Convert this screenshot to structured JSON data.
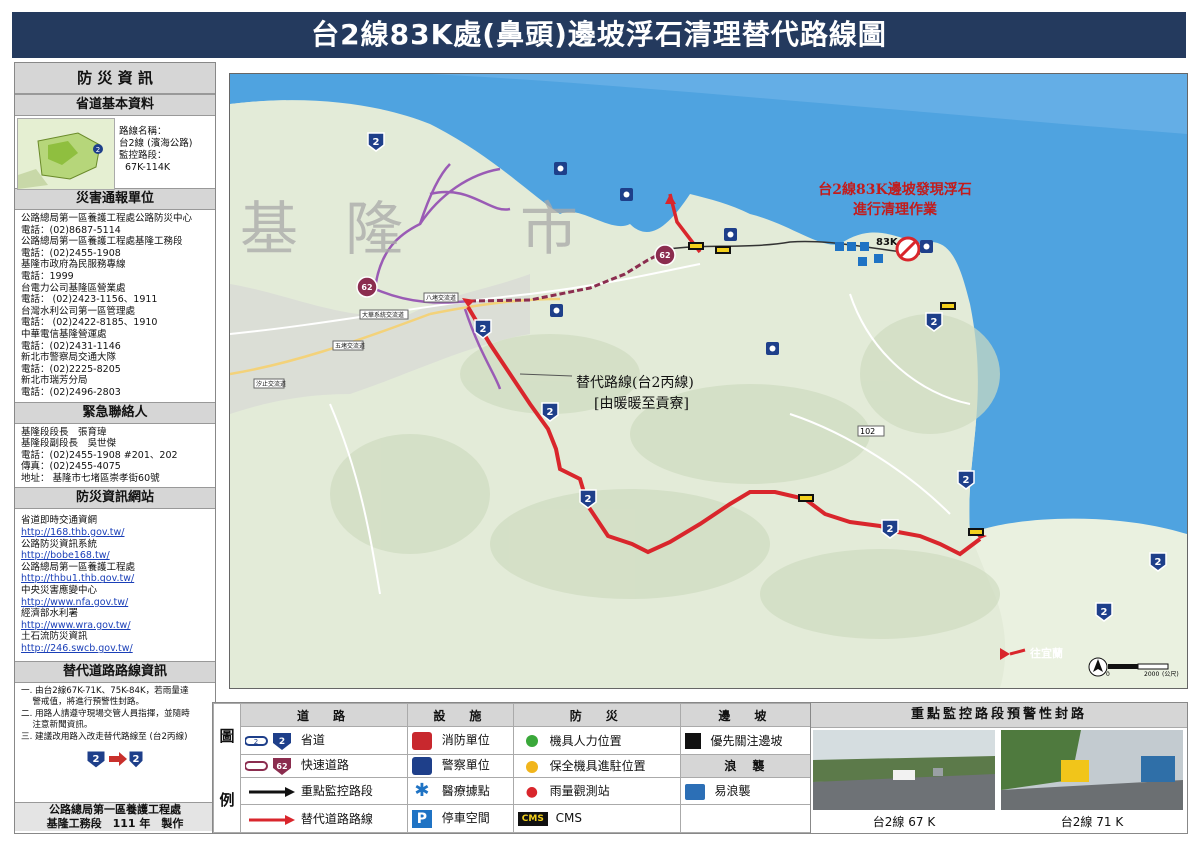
{
  "title": "台2線83K處(鼻頭)邊坡浮石清理替代路線圖",
  "sidebar": {
    "header": "防 災 資 訊",
    "basic_header": "省道基本資料",
    "road_info": [
      "路線名稱：",
      "台2線 (濱海公路)",
      "監控路段：",
      "67K-114K"
    ],
    "report_header": "災害通報單位",
    "report_lines": [
      "公路總局第一區養護工程處公路防災中心",
      "電話：(02)8687-5114",
      "公路總局第一區養護工程處基隆工務段",
      "電話：(02)2455-1908",
      "基隆市政府為民服務專線",
      "電話：1999",
      "台電力公司基隆區營業處",
      "電話： (02)2423-1156、1911",
      "台灣水利公司第一區管理處",
      "電話： (02)2422-8185、1910",
      "中華電信基隆營運處",
      "電話：(02)2431-1146",
      "新北市警察局交通大隊",
      "電話：(02)2225-8205",
      "新北市瑞芳分局",
      "電話：(02)2496-2803"
    ],
    "contact_header": "緊急聯絡人",
    "contact_lines": [
      "基隆段段長　張育瑋",
      "基隆段副段長　吳世傑",
      "電話：(02)2455-1908 #201、202",
      "傳真：(02)2455-4075",
      "地址： 基隆市七堵區崇孝街60號"
    ],
    "web_header": "防災資訊網站",
    "web_items": [
      {
        "label": "省道即時交通資網",
        "url": "http://168.thb.gov.tw/"
      },
      {
        "label": "公路防災資訊系統",
        "url": "http://bobe168.tw/"
      },
      {
        "label": "公路總局第一區養護工程處",
        "url": "http://thbu1.thb.gov.tw/"
      },
      {
        "label": "中央災害應變中心",
        "url": "http://www.nfa.gov.tw/"
      },
      {
        "label": "經濟部水利署",
        "url": "http://www.wra.gov.tw/"
      },
      {
        "label": "土石流防災資訊",
        "url": "http://246.swcb.gov.tw/"
      }
    ],
    "detour_header": "替代道路路線資訊",
    "detour_lines": [
      "一. 由台2線67K-71K、75K-84K，若雨量達",
      "　 警戒值，將進行預警性封路。",
      "二. 用路人請遵守現場交管人員指揮，並隨時",
      "　 注意新聞資訊。",
      "三. 建議改用路入改走替代路線至 (台2丙線)"
    ],
    "footer": [
      "公路總局第一區養護工程處",
      "基隆工務段　111 年　製作"
    ]
  },
  "map": {
    "city_label": [
      "基",
      "隆",
      "市"
    ],
    "alert_text": [
      "台2線83K邊坡發現浮石",
      "進行清理作業"
    ],
    "km_label": "83K",
    "detour_label": [
      "替代路線(台2丙線)",
      "[由暖暖至貢寮]"
    ],
    "toward_label": "往宜蘭",
    "scale_labels": [
      "0",
      "2000",
      "(公尺)"
    ],
    "road_numbers": {
      "prov": "2",
      "exp": "62",
      "alt": "102"
    },
    "interchange_labels": [
      "八堵交流道",
      "大華系統交流道",
      "五堵交流道",
      "汐止交流道"
    ],
    "colors": {
      "sea": "#4fa3e0",
      "land": "#e6ecdc",
      "detour": "#d9262c",
      "exp": "#8b2d4f",
      "purple_road": "#9a5bb5"
    }
  },
  "legend": {
    "side_label": [
      "圖",
      "例"
    ],
    "col_headers": [
      "道　路",
      "設　施",
      "防　災",
      "邊　坡"
    ],
    "rows": [
      {
        "road": "省道",
        "facility": "消防單位",
        "disaster": "機具人力位置",
        "slope": "優先關注邊坡"
      },
      {
        "road": "快速道路",
        "facility": "警察單位",
        "disaster": "保全機具進駐位置",
        "slope": "浪　襲"
      },
      {
        "road": "重點監控路段",
        "facility": "醫療據點",
        "disaster": "雨量觀測站",
        "slope": "易浪襲"
      },
      {
        "road": "替代道路路線",
        "facility": "停車空間",
        "disaster": "CMS",
        "slope": ""
      }
    ]
  },
  "photos": {
    "header": "重點監控路段預警性封路",
    "captions": [
      "台2線 67 K",
      "台2線 71 K"
    ]
  }
}
